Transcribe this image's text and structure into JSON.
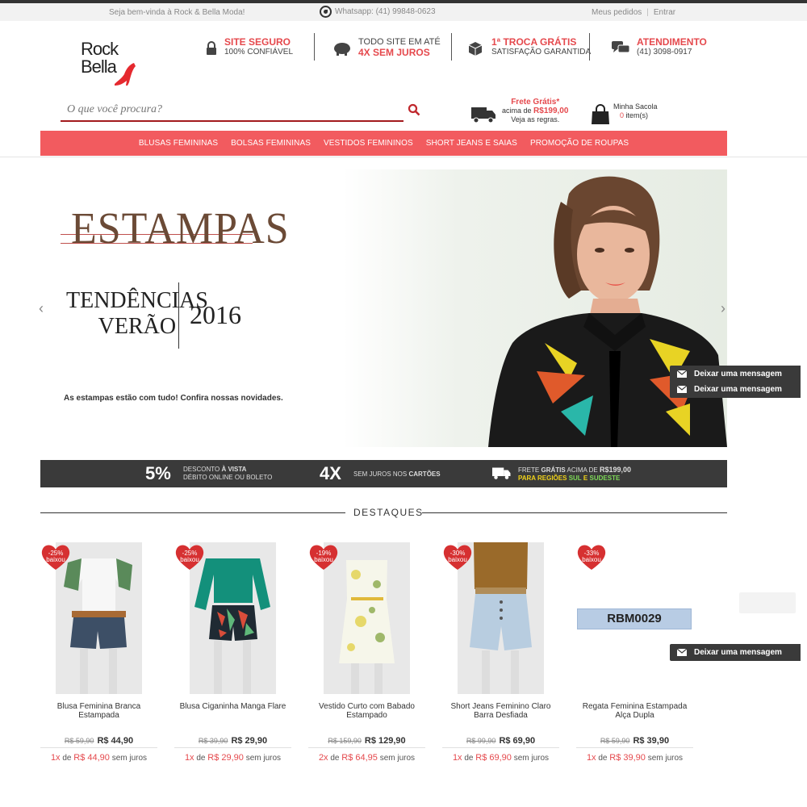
{
  "topbar": {
    "welcome": "Seja bem-vinda à Rock & Bella Moda!",
    "whatsapp": "Whatsapp: (41) 99848-0623",
    "my_orders": "Meus pedidos",
    "separator": "|",
    "login": "Entrar"
  },
  "logo": {
    "line1": "Rock",
    "line2": "Bella"
  },
  "features": [
    {
      "title": "SITE SEGURO",
      "subtitle": "100% CONFIÁVEL",
      "icon": "lock-icon"
    },
    {
      "title": "TODO SITE EM ATÉ",
      "subtitle": "4X SEM JUROS",
      "icon": "piggy-bank-icon"
    },
    {
      "title": "1ª TROCA GRÁTIS",
      "subtitle": "SATISFAÇÃO GARANTIDA",
      "icon": "box-icon"
    },
    {
      "title": "ATENDIMENTO",
      "subtitle": "(41) 3098-0917",
      "icon": "chat-icon"
    }
  ],
  "search": {
    "placeholder": "O que você procura?"
  },
  "shipping": {
    "title": "Frete Grátis*",
    "line2_prefix": "acima de",
    "line2_value": "R$199,00",
    "line3": "Veja as regras."
  },
  "bag": {
    "label": "Minha Sacola",
    "count": "0",
    "count_suffix": "item(s)"
  },
  "nav": [
    "BLUSAS FEMININAS",
    "BOLSAS FEMININAS",
    "VESTIDOS FEMININOS",
    "SHORT JEANS E SAIAS",
    "PROMOÇÃO DE ROUPAS"
  ],
  "banner": {
    "title": "ESTAMPAS",
    "tend_line1": "TENDÊNCIAS",
    "tend_line2": "VERÃO",
    "year": "2016",
    "subtitle": "As estampas estão com tudo! Confira nossas novidades."
  },
  "promo": {
    "pct": "5%",
    "pct_l1_a": "DESCONTO",
    "pct_l1_b": "À VISTA",
    "pct_l2": "DÉBITO ONLINE OU BOLETO",
    "x": "4X",
    "x_l1_a": "SEM JUROS NOS",
    "x_l1_b": "CARTÕES",
    "frete_l1_a": "FRETE",
    "frete_l1_b": "GRÁTIS",
    "frete_l1_c": "ACIMA DE",
    "frete_l1_d": "R$199,00",
    "frete_l2_a": "PARA REGIÕES",
    "frete_l2_b": "SUL",
    "frete_l2_c": "E",
    "frete_l2_d": "SUDESTE"
  },
  "section_title": "DESTAQUES",
  "products": [
    {
      "badge": "-25%",
      "badge_sub": "baixou",
      "name": "Blusa Feminina Branca Estampada",
      "old_price": "R$ 59,90",
      "price": "R$ 44,90",
      "inst_n": "1x",
      "inst_de": "de",
      "inst_value": "R$ 44,90",
      "inst_suffix": "sem juros"
    },
    {
      "badge": "-25%",
      "badge_sub": "baixou",
      "name": "Blusa Ciganinha Manga Flare",
      "old_price": "R$ 39,90",
      "price": "R$ 29,90",
      "inst_n": "1x",
      "inst_de": "de",
      "inst_value": "R$ 29,90",
      "inst_suffix": "sem juros"
    },
    {
      "badge": "-19%",
      "badge_sub": "baixou",
      "name": "Vestido Curto com Babado Estampado",
      "old_price": "R$ 159,90",
      "price": "R$ 129,90",
      "inst_n": "2x",
      "inst_de": "de",
      "inst_value": "R$ 64,95",
      "inst_suffix": "sem juros"
    },
    {
      "badge": "-30%",
      "badge_sub": "baixou",
      "name": "Short Jeans Feminino Claro Barra Desfiada",
      "old_price": "R$ 99,90",
      "price": "R$ 69,90",
      "inst_n": "1x",
      "inst_de": "de",
      "inst_value": "R$ 69,90",
      "inst_suffix": "sem juros"
    },
    {
      "badge": "-33%",
      "badge_sub": "baixou",
      "name": "Regata Feminina Estampada Alça Dupla",
      "old_price": "R$ 59,90",
      "price": "R$ 39,90",
      "inst_n": "1x",
      "inst_de": "de",
      "inst_value": "R$ 39,90",
      "inst_suffix": "sem juros"
    }
  ],
  "placeholder_code": "RBM0029",
  "chat_label": "Deixar uma mensagem",
  "colors": {
    "accent": "#f25b5f",
    "red": "#e5494d",
    "dark": "#3a3a3a"
  }
}
